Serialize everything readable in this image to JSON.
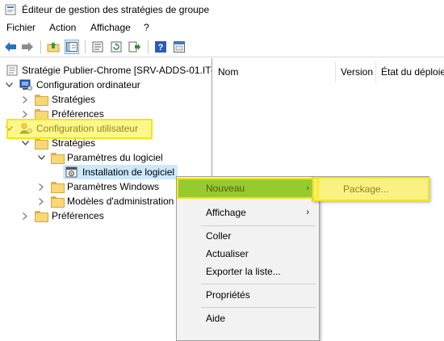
{
  "window": {
    "title": "Éditeur de gestion des stratégies de groupe",
    "icon": "gpo-editor-icon"
  },
  "menu": {
    "items": [
      "Fichier",
      "Action",
      "Affichage",
      "?"
    ]
  },
  "toolbar": {
    "buttons": [
      "back-arrow-icon",
      "forward-arrow-icon",
      "up-folder-icon",
      "show-hide-tree-icon",
      "properties-icon",
      "refresh-icon",
      "export-list-icon",
      "help-icon",
      "console-view-icon"
    ]
  },
  "tree": {
    "root": "Stratégie Publier-Chrome [SRV-ADDS-01.IT-C",
    "computer_config": "Configuration ordinateur",
    "computer_strategies": "Stratégies",
    "computer_preferences": "Préférences",
    "user_config": "Configuration utilisateur",
    "user_strategies": "Stratégies",
    "software_settings": "Paramètres du logiciel",
    "software_installation": "Installation de logiciel",
    "windows_settings": "Paramètres Windows",
    "admin_templates": "Modèles d'administration",
    "user_preferences": "Préférences"
  },
  "list": {
    "columns": [
      "Nom",
      "Version",
      "État du déploie"
    ]
  },
  "context_menu": {
    "new": "Nouveau",
    "view": "Affichage",
    "paste": "Coller",
    "refresh": "Actualiser",
    "export": "Exporter la liste...",
    "properties": "Propriétés",
    "help": "Aide"
  },
  "submenu": {
    "package": "Package..."
  },
  "colors": {
    "menu_highlight": "#5fb533",
    "annotation": "#f5e31c",
    "selection": "#cce8ff"
  }
}
